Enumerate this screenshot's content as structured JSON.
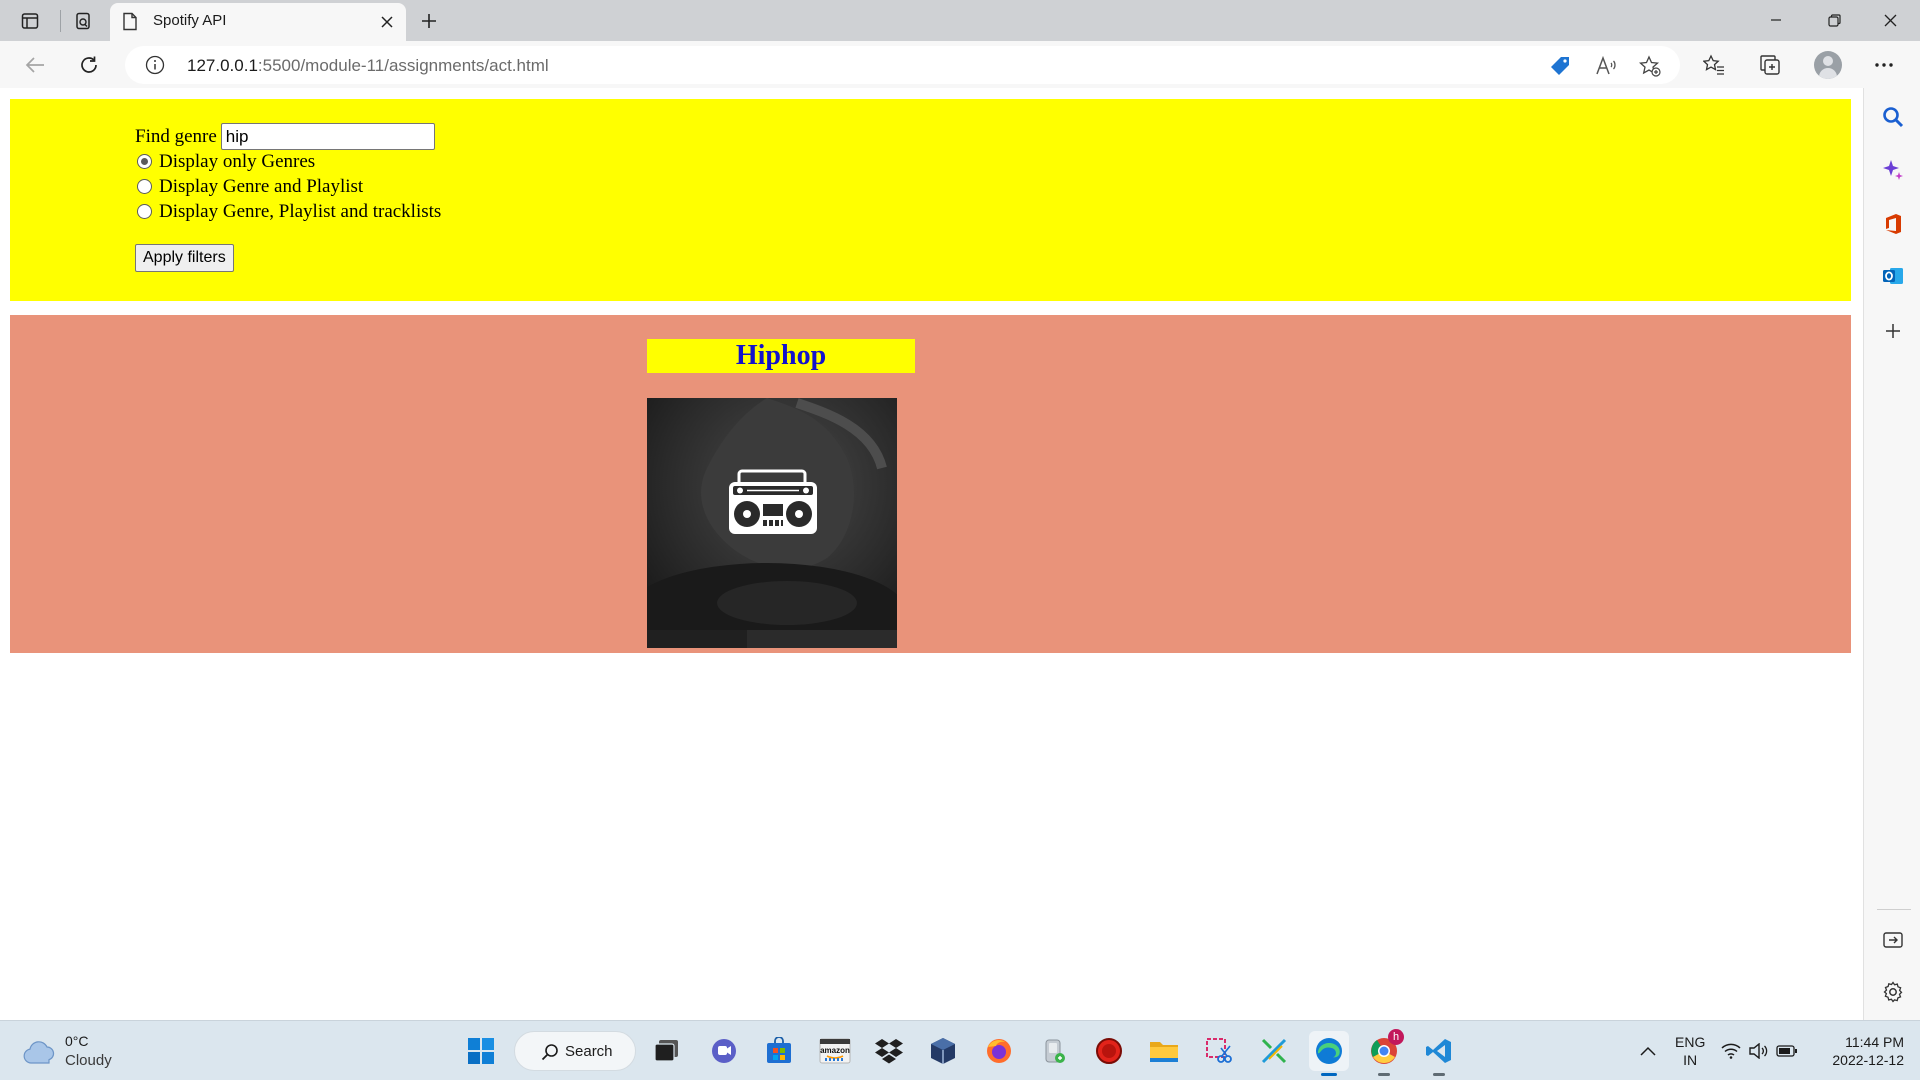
{
  "browser": {
    "tab_title": "Spotify API",
    "url_host": "127.0.0.1",
    "url_path": ":5500/module-11/assignments/act.html"
  },
  "filters": {
    "find_label": "Find genre",
    "search_value": "hip",
    "options": [
      {
        "label": "Display only Genres",
        "checked": true
      },
      {
        "label": "Display Genre and Playlist",
        "checked": false
      },
      {
        "label": "Display Genre, Playlist and tracklists",
        "checked": false
      }
    ],
    "apply_label": "Apply filters"
  },
  "results": {
    "genre_title": "Hiphop"
  },
  "colors": {
    "filter_bg": "#ffff00",
    "results_bg": "#e9937a",
    "title_text": "#1212cc"
  },
  "taskbar": {
    "temperature": "0°C",
    "condition": "Cloudy",
    "search_label": "Search",
    "lang_1": "ENG",
    "lang_2": "IN",
    "time": "11:44 PM",
    "date": "2022-12-12",
    "chrome_badge": "h"
  }
}
